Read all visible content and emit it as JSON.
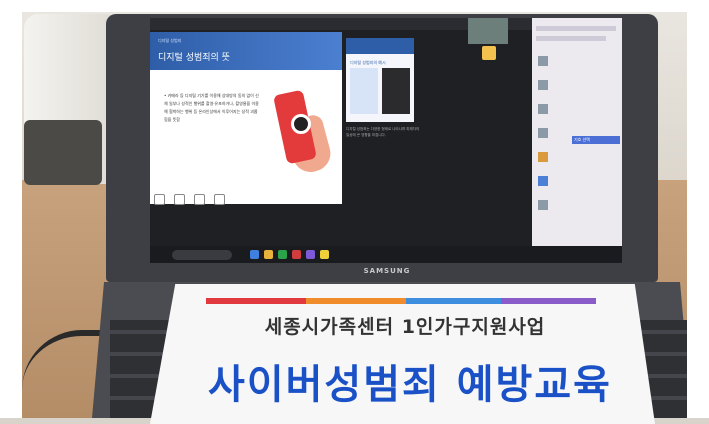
{
  "sign": {
    "subtitle": "세종시가족센터 1인가구지원사업",
    "title": "사이버성범죄 예방교육",
    "stripe_colors": [
      "#e0393e",
      "#f08c2a",
      "#3e8ee0",
      "#8a5cc9"
    ]
  },
  "laptop": {
    "brand": "SAMSUNG"
  },
  "slide": {
    "tag": "디지털 성범죄",
    "title": "디지털 성범죄의 뜻",
    "body": "• 카메라 등 디지털 기기를 이용해 상대방의 동의 없이 신체 일부나 성적인 행위를 촬영·유포하거나, 촬영물을 이용해 협박하는 행위 등 온라인상에서 이루어지는 성적 괴롭힘을 뜻함"
  },
  "slide2": {
    "title": "디지털 성범죄의 예시"
  },
  "notes": "디지털 성범죄는 다양한 형태로 나타나며 피해자의 일상에 큰 영향을 미칩니다.",
  "chat": {
    "highlight": "기호 선택"
  },
  "colors": {
    "accent": "#1b51c6",
    "laptop": "#3d3f44"
  }
}
